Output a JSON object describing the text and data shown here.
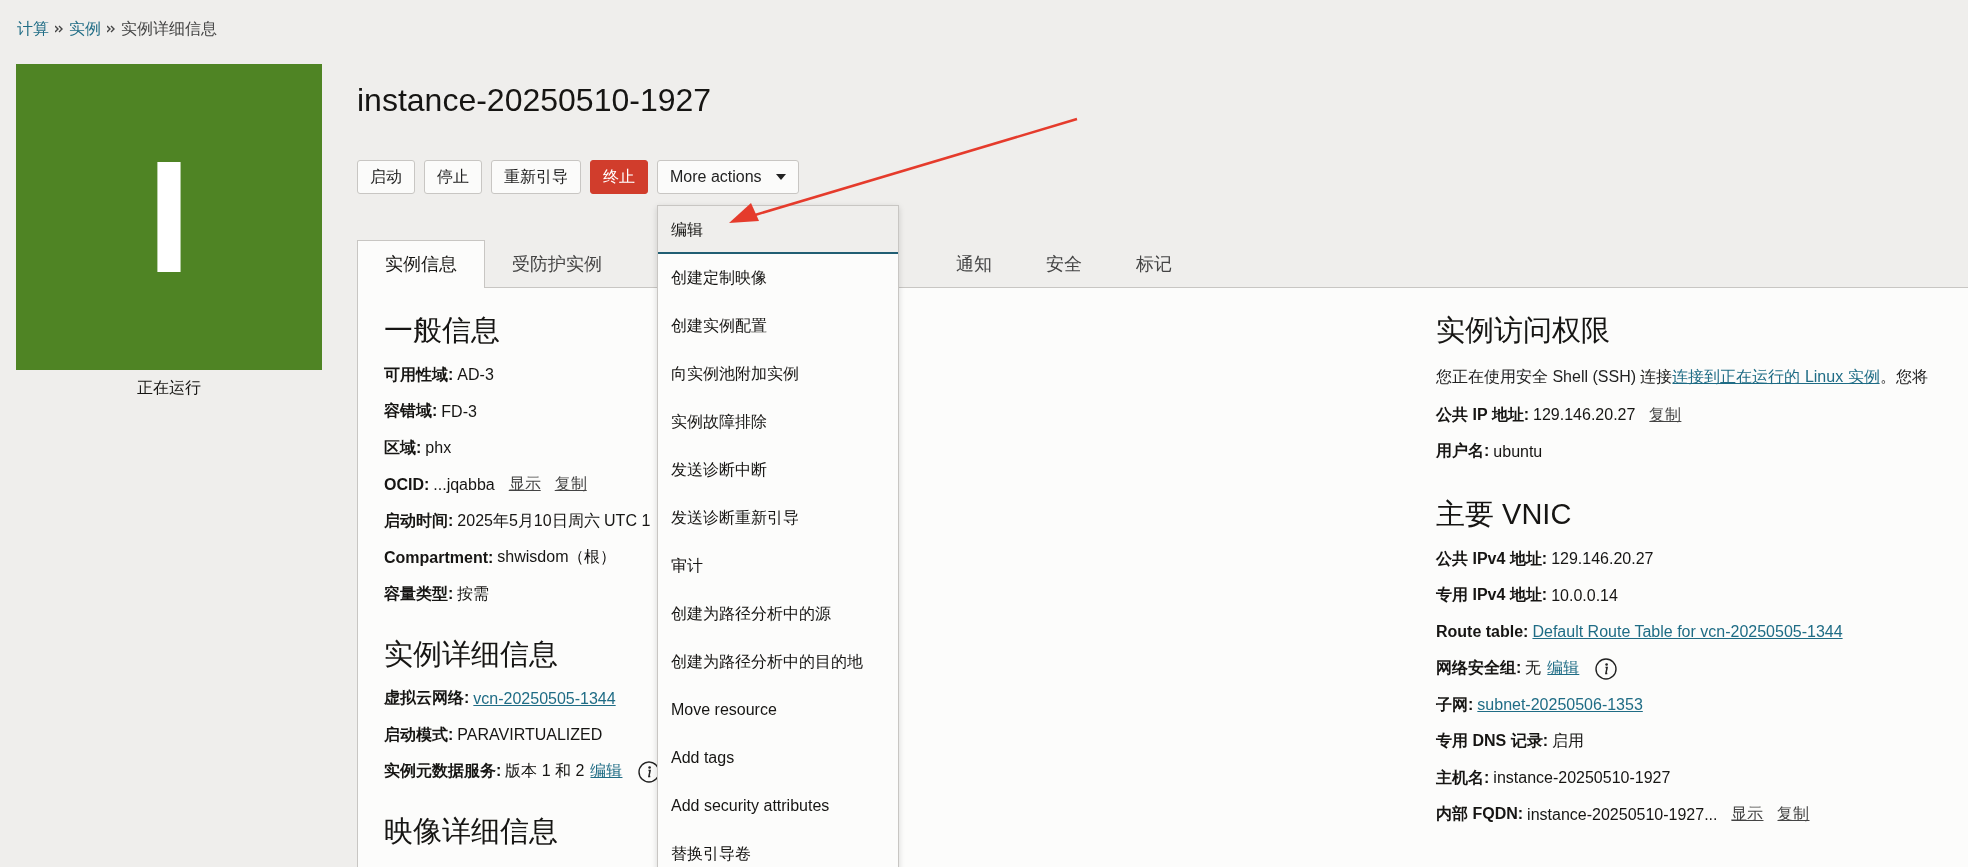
{
  "breadcrumb": [
    {
      "label": "计算",
      "link": true
    },
    {
      "label": "实例",
      "link": true
    },
    {
      "label": "实例详细信息",
      "link": false
    }
  ],
  "instance": {
    "initial": "I",
    "status": "正在运行"
  },
  "title": "instance-20250510-1927",
  "buttons": [
    {
      "label": "启动",
      "kind": "default"
    },
    {
      "label": "停止",
      "kind": "default"
    },
    {
      "label": "重新引导",
      "kind": "default"
    },
    {
      "label": "终止",
      "kind": "danger"
    },
    {
      "label": "More actions",
      "kind": "menu"
    }
  ],
  "more_actions_menu": [
    {
      "label": "编辑",
      "selected": true
    },
    {
      "label": "创建定制映像",
      "selected": false
    },
    {
      "label": "创建实例配置",
      "selected": false
    },
    {
      "label": "向实例池附加实例",
      "selected": false
    },
    {
      "label": "实例故障排除",
      "selected": false
    },
    {
      "label": "发送诊断中断",
      "selected": false
    },
    {
      "label": "发送诊断重新引导",
      "selected": false
    },
    {
      "label": "审计",
      "selected": false
    },
    {
      "label": "创建为路径分析中的源",
      "selected": false
    },
    {
      "label": "创建为路径分析中的目的地",
      "selected": false
    },
    {
      "label": "Move resource",
      "selected": false
    },
    {
      "label": "Add tags",
      "selected": false
    },
    {
      "label": "Add security attributes",
      "selected": false
    },
    {
      "label": "替换引导卷",
      "selected": false
    }
  ],
  "tabs": [
    {
      "label": "实例信息",
      "selected": true
    },
    {
      "label": "受防护实例",
      "selected": false
    },
    {
      "label": "通知",
      "selected": false
    },
    {
      "label": "安全",
      "selected": false
    },
    {
      "label": "标记",
      "selected": false
    }
  ],
  "left_sections": [
    {
      "heading": "一般信息",
      "fields": [
        {
          "label": "可用性域:",
          "value": "AD-3"
        },
        {
          "label": "容错域:",
          "value": "FD-3"
        },
        {
          "label": "区域:",
          "value": "phx"
        },
        {
          "label": "OCID:",
          "value": "...jqabba",
          "links": [
            {
              "text": "显示",
              "kind": "action"
            },
            {
              "text": "复制",
              "kind": "action"
            }
          ]
        },
        {
          "label": "启动时间:",
          "value": "2025年5月10日周六 UTC 1"
        },
        {
          "label": "Compartment:",
          "value": "shwisdom（根）"
        },
        {
          "label": "容量类型:",
          "value": "按需"
        }
      ]
    },
    {
      "heading": "实例详细信息",
      "fields": [
        {
          "label": "虚拟云网络:",
          "links": [
            {
              "text": "vcn-20250505-1344",
              "kind": "nav"
            }
          ]
        },
        {
          "label": "启动模式:",
          "value": "PARAVIRTUALIZED"
        },
        {
          "label": "实例元数据服务:",
          "value": "版本 1 和 2",
          "links": [
            {
              "text": "编辑",
              "kind": "nav"
            }
          ],
          "info": true
        }
      ]
    },
    {
      "heading": "映像详细信息"
    }
  ],
  "access": {
    "heading": "实例访问权限",
    "intro": {
      "before": "您正在使用安全 Shell (SSH) 连接",
      "link": "连接到正在运行的 Linux 实例",
      "after": "。您将"
    },
    "fields": [
      {
        "label": "公共 IP 地址:",
        "value": "129.146.20.27",
        "links": [
          {
            "text": "复制",
            "kind": "action"
          }
        ]
      },
      {
        "label": "用户名:",
        "value": "ubuntu"
      }
    ]
  },
  "primary_vnic": {
    "heading": "主要 VNIC",
    "fields": [
      {
        "label": "公共 IPv4 地址:",
        "value": "129.146.20.27"
      },
      {
        "label": "专用 IPv4 地址:",
        "value": "10.0.0.14"
      },
      {
        "label": "Route table:",
        "links": [
          {
            "text": "Default Route Table for vcn-20250505-1344",
            "kind": "nav"
          }
        ]
      },
      {
        "label": "网络安全组:",
        "value": "无",
        "links": [
          {
            "text": "编辑",
            "kind": "nav"
          }
        ],
        "info": true
      },
      {
        "label": "子网:",
        "links": [
          {
            "text": "subnet-20250506-1353",
            "kind": "nav"
          }
        ]
      },
      {
        "label": "专用 DNS 记录:",
        "value": "启用"
      },
      {
        "label": "主机名:",
        "value": "instance-20250510-1927"
      },
      {
        "label": "内部 FQDN:",
        "value": "instance-20250510-1927...",
        "links": [
          {
            "text": "显示",
            "kind": "action"
          },
          {
            "text": "复制",
            "kind": "action"
          }
        ]
      }
    ]
  }
}
